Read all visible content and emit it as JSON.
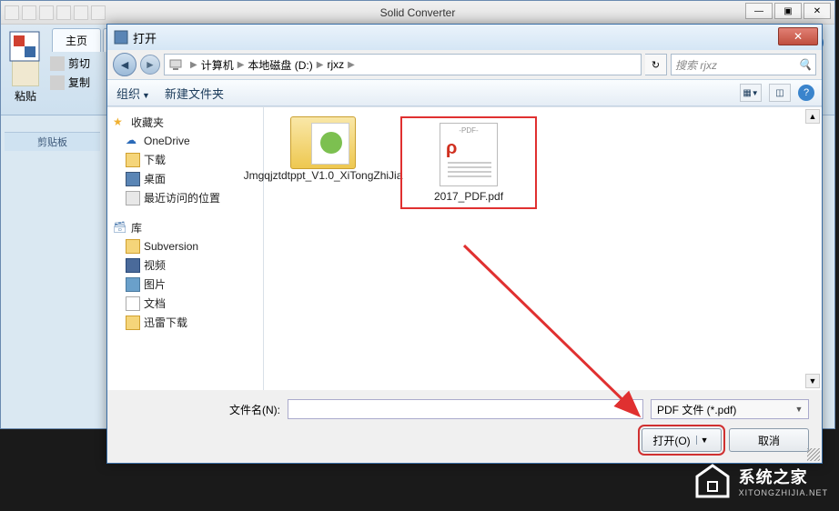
{
  "app": {
    "title": "Solid Converter"
  },
  "ribbon": {
    "tab_home": "主页",
    "paste_label": "粘贴",
    "cut_label": "剪切",
    "copy_label": "复制",
    "clipboard_group": "剪贴板"
  },
  "dialog": {
    "title": "打开",
    "breadcrumb": {
      "computer": "计算机",
      "disk": "本地磁盘 (D:)",
      "folder": "rjxz"
    },
    "search_placeholder": "搜索 rjxz",
    "toolbar": {
      "organize": "组织",
      "new_folder": "新建文件夹"
    },
    "sidebar": {
      "favorites": "收藏夹",
      "fav_items": [
        "OneDrive",
        "下载",
        "桌面",
        "最近访问的位置"
      ],
      "libs": "库",
      "lib_items": [
        "Subversion",
        "视频",
        "图片",
        "文档",
        "迅雷下载"
      ]
    },
    "files": [
      {
        "name": "Jmgqjztdtppt_V1.0_XiTongZhiJia",
        "type": "folder"
      },
      {
        "name": "2017_PDF.pdf",
        "type": "pdf"
      }
    ],
    "footer": {
      "filename_label": "文件名(N):",
      "filename_value": "",
      "filter": "PDF 文件 (*.pdf)",
      "open_btn": "打开(O)",
      "cancel_btn": "取消"
    }
  },
  "watermark": {
    "cn": "系统之家",
    "en": "XITONGZHIJIA.NET"
  }
}
